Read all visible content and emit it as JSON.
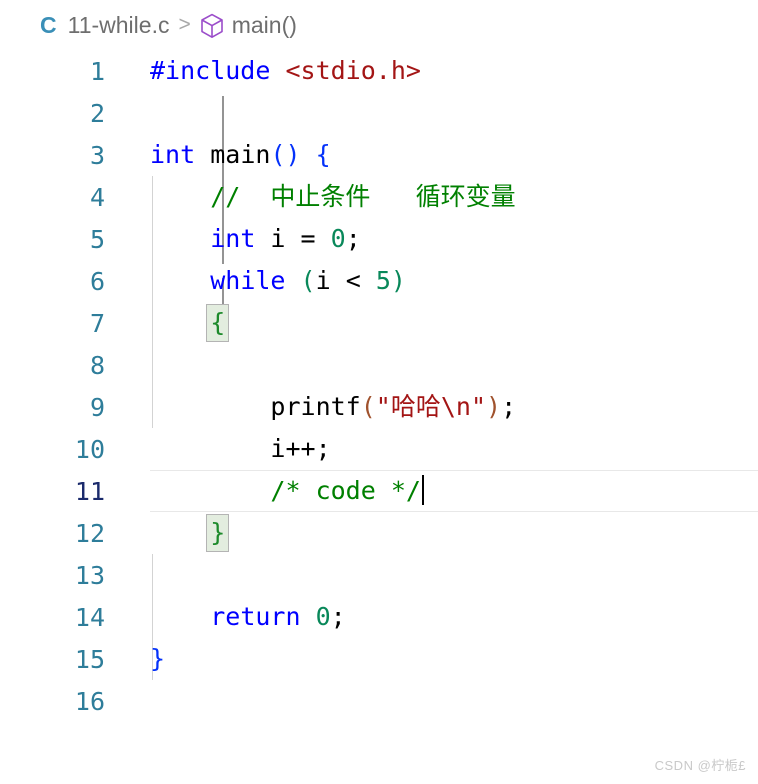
{
  "breadcrumb": {
    "language_icon": "c-language-icon",
    "language_letter": "C",
    "file_name": "11-while.c",
    "separator": ">",
    "symbol_icon": "cube-symbol-icon",
    "symbol_name": "main()"
  },
  "editor": {
    "active_line_number": 11,
    "total_lines": 16,
    "colors": {
      "keyword": "#0000ff",
      "string": "#a31515",
      "comment": "#008000",
      "number": "#09885a",
      "plain": "#000000",
      "line_number": "#2e7d9a",
      "active_line_number": "#1a2a6c",
      "bracket_paren": "#a0522d",
      "background": "#ffffff"
    },
    "lines": [
      {
        "n": "1",
        "text": "#include <stdio.h>"
      },
      {
        "n": "2",
        "text": ""
      },
      {
        "n": "3",
        "text": "int main() {"
      },
      {
        "n": "4",
        "text": "    //  中止条件   循环变量"
      },
      {
        "n": "5",
        "text": "    int i = 0;"
      },
      {
        "n": "6",
        "text": "    while (i < 5)"
      },
      {
        "n": "7",
        "text": "    {"
      },
      {
        "n": "8",
        "text": ""
      },
      {
        "n": "9",
        "text": "        printf(\"哈哈\\n\");"
      },
      {
        "n": "10",
        "text": "        i++;"
      },
      {
        "n": "11",
        "text": "        /* code */"
      },
      {
        "n": "12",
        "text": "    }"
      },
      {
        "n": "13",
        "text": ""
      },
      {
        "n": "14",
        "text": "    return 0;"
      },
      {
        "n": "15",
        "text": "}"
      },
      {
        "n": "16",
        "text": ""
      }
    ],
    "tokens": {
      "l1_include": "#include",
      "l1_header": " <stdio.h>",
      "l3_int": "int",
      "l3_space": " ",
      "l3_main": "main",
      "l3_parens": "()",
      "l3_sp2": " ",
      "l3_brace": "{",
      "l4_comment": "//  中止条件   循环变量",
      "l5_int": "int",
      "l5_ivar": " i = ",
      "l5_zero": "0",
      "l5_semi": ";",
      "l6_while": "while",
      "l6_sp": " ",
      "l6_lparen": "(",
      "l6_cond": "i < ",
      "l6_five": "5",
      "l6_rparen": ")",
      "l7_brace": "{",
      "l9_printf": "printf",
      "l9_lparen": "(",
      "l9_string": "\"哈哈\\n\"",
      "l9_rparen": ")",
      "l9_semi": ";",
      "l10_incr": "i++;",
      "l11_comment": "/* code */",
      "l12_brace": "}",
      "l14_return": "return",
      "l14_sp": " ",
      "l14_zero": "0",
      "l14_semi": ";",
      "l15_brace": "}"
    }
  },
  "watermark": {
    "text": "CSDN @柠栀£"
  }
}
